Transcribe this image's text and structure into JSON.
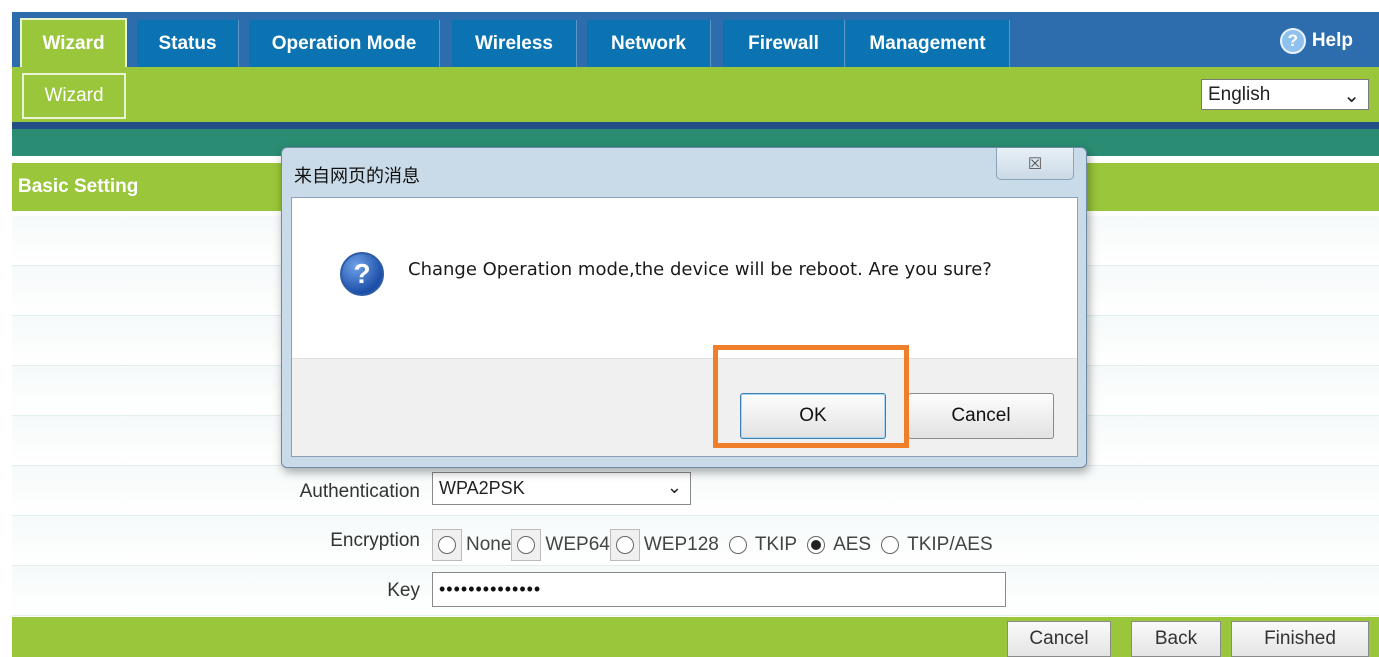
{
  "nav": {
    "tabs": [
      {
        "label": "Wizard"
      },
      {
        "label": "Status"
      },
      {
        "label": "Operation Mode"
      },
      {
        "label": "Wireless"
      },
      {
        "label": "Network"
      },
      {
        "label": "Firewall"
      },
      {
        "label": "Management"
      }
    ],
    "help_label": "Help",
    "help_icon": "help-circle-icon"
  },
  "subnav": {
    "tab_label": "Wizard",
    "language": "English"
  },
  "section": {
    "title": "Basic Setting"
  },
  "form": {
    "authentication": {
      "label": "Authentication",
      "value": "WPA2PSK"
    },
    "encryption": {
      "label": "Encryption",
      "options": [
        {
          "label": "None",
          "selected": false
        },
        {
          "label": "WEP64",
          "selected": false
        },
        {
          "label": "WEP128",
          "selected": false
        },
        {
          "label": "TKIP",
          "selected": false
        },
        {
          "label": "AES",
          "selected": true
        },
        {
          "label": "TKIP/AES",
          "selected": false
        }
      ]
    },
    "key": {
      "label": "Key",
      "value": "••••••••••••••"
    }
  },
  "footer": {
    "cancel_label": "Cancel",
    "back_label": "Back",
    "finished_label": "Finished"
  },
  "dialog": {
    "title": "来自网页的消息",
    "close_glyph": "☒",
    "message": "Change Operation mode,the device will be reboot. Are you sure?",
    "ok_label": "OK",
    "cancel_label": "Cancel"
  },
  "colors": {
    "nav_blue": "#0b73b2",
    "brand_green": "#99c63a",
    "highlight_orange": "#f07f2a"
  }
}
